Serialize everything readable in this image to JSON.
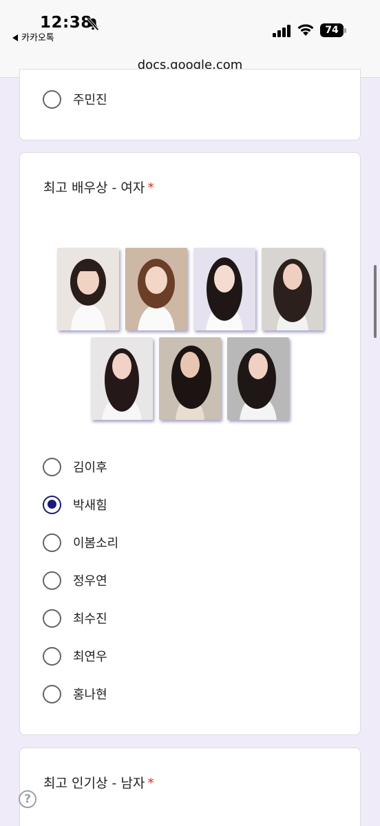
{
  "status": {
    "time": "12:38",
    "back_app": "카카오톡",
    "battery": "74"
  },
  "browser": {
    "url": "docs.google.com"
  },
  "prev_question": {
    "options": [
      "주민진"
    ]
  },
  "question_actress": {
    "title": "최고 배우상 - 여자",
    "required_mark": "*",
    "selected": "박새힘",
    "options": [
      "김이후",
      "박새힘",
      "이봄소리",
      "정우연",
      "최수진",
      "최연우",
      "홍나현"
    ]
  },
  "question_popular_male": {
    "title": "최고 인기상 - 남자",
    "required_mark": "*"
  },
  "icons": {
    "bell": "bell-slash-icon",
    "signal": "cellular-signal-icon",
    "wifi": "wifi-icon",
    "battery": "battery-icon",
    "help": "help-icon"
  },
  "colors": {
    "page_bg": "#f0ebf8",
    "selected_radio": "#1a1a7a",
    "required": "#d93025"
  }
}
